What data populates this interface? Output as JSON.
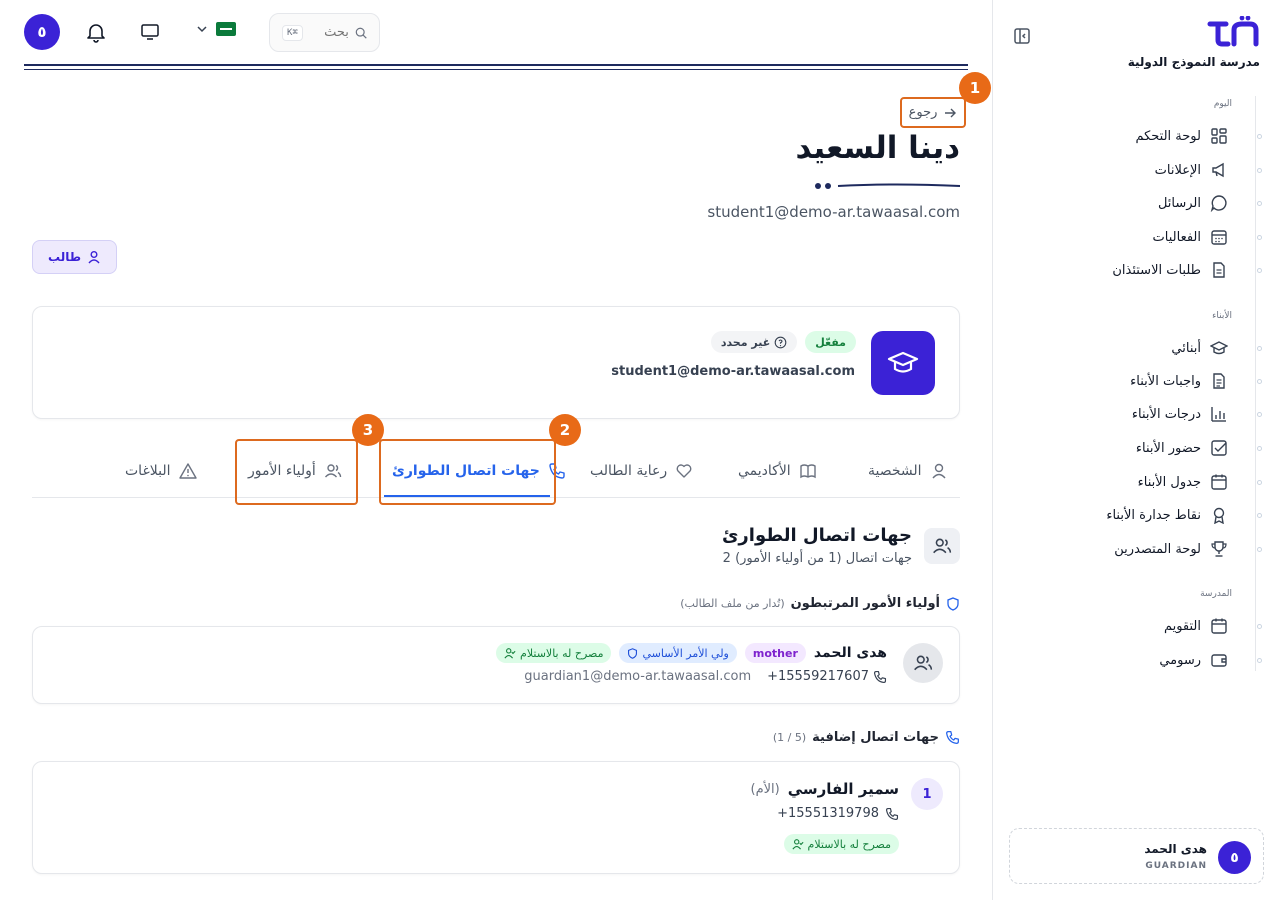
{
  "app": {
    "school_name": "مدرسة النموذج الدولية"
  },
  "header": {
    "avatar_letter": "٥",
    "search_placeholder": "بحث",
    "search_shortcut": "K⌘"
  },
  "sidebar": {
    "sections": [
      {
        "title": "اليوم",
        "items": [
          "لوحة التحكم",
          "الإعلانات",
          "الرسائل",
          "الفعاليات",
          "طلبات الاستئذان"
        ]
      },
      {
        "title": "الأبناء",
        "items": [
          "أبنائي",
          "واجبات الأبناء",
          "درجات الأبناء",
          "حضور الأبناء",
          "جدول الأبناء",
          "نقاط جدارة الأبناء",
          "لوحة المتصدرين"
        ]
      },
      {
        "title": "المدرسة",
        "items": [
          "التقويم",
          "رسومي"
        ]
      }
    ],
    "user": {
      "avatar_letter": "٥",
      "name": "هدى الحمد",
      "role": "GUARDIAN"
    }
  },
  "page": {
    "back_label": "رجوع",
    "title": "دينا السعيد",
    "email": "student1@demo-ar.tawaasal.com",
    "role_chip": "طالب",
    "annotations": [
      "1",
      "2",
      "3"
    ]
  },
  "profile": {
    "status_active": "مفعّل",
    "status_unspecified": "غير محدد",
    "email": "student1@demo-ar.tawaasal.com"
  },
  "tabs": [
    {
      "label": "الشخصية",
      "icon": "user-icon"
    },
    {
      "label": "الأكاديمي",
      "icon": "book-icon"
    },
    {
      "label": "رعاية الطالب",
      "icon": "heart-icon"
    },
    {
      "label": "جهات اتصال الطوارئ",
      "icon": "phone-icon",
      "active": true
    },
    {
      "label": "أولياء الأمور",
      "icon": "users-icon"
    },
    {
      "label": "البلاغات",
      "icon": "warning-icon"
    }
  ],
  "emergency": {
    "title": "جهات اتصال الطوارئ",
    "subtitle": "2 جهات اتصال (1 من أولياء الأمور)",
    "linked_title": "أولياء الأمور المرتبطون",
    "linked_note": "(تُدار من ملف الطالب)",
    "guardian": {
      "name": "هدى الحمد",
      "relation_tag": "mother",
      "primary_tag": "ولي الأمر الأساسي",
      "pickup_tag": "مصرح له بالاستلام",
      "phone": "+15559217607",
      "email": "guardian1@demo-ar.tawaasal.com"
    },
    "extra_title": "جهات اتصال إضافية",
    "extra_count": "(1 / 5)",
    "contact": {
      "index": "1",
      "name": "سمير الفارسي",
      "relation": "(الأم)",
      "phone": "+15551319798",
      "pickup_tag": "مصرح له بالاستلام"
    }
  },
  "colors": {
    "primary": "#3b22d6",
    "accent_blue": "#2563eb",
    "annotation_orange": "#e86a17"
  }
}
